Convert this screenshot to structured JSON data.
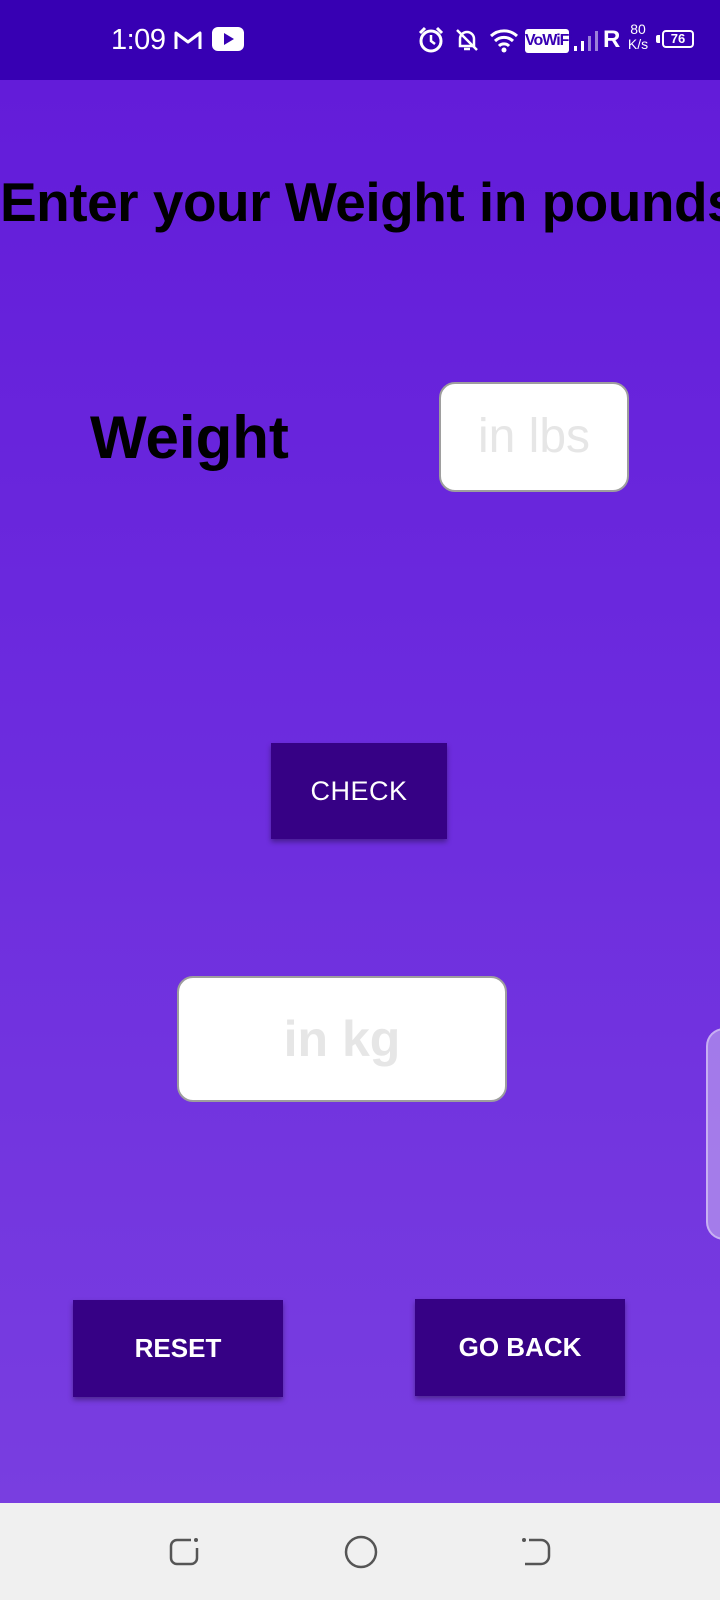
{
  "status_bar": {
    "time": "1:09",
    "icons": [
      "gmail-icon",
      "youtube-icon",
      "alarm-icon",
      "notifications-off-icon",
      "wifi-icon",
      "vowifi-icon",
      "signal-icon"
    ],
    "vowifi_label": "VoWiFi",
    "roaming_label": "R",
    "speed_value": "80",
    "speed_unit": "K/s",
    "battery_level": "76"
  },
  "main": {
    "heading": "Enter your Weight in pounds",
    "weight_label": "Weight",
    "lbs_input": {
      "value": "",
      "placeholder": "in lbs"
    },
    "check_button": "CHECK",
    "kg_output": {
      "value": "",
      "placeholder": "in kg"
    },
    "reset_button": "RESET",
    "go_back_button": "GO BACK"
  },
  "navigation_bar": {
    "buttons": [
      "recent-apps-icon",
      "home-icon",
      "back-icon"
    ]
  },
  "colors": {
    "status_bar": "#3700b3",
    "background_top": "#631cd9",
    "background_bottom": "#793ee0",
    "button": "#360185",
    "input_background": "#ffffff",
    "placeholder_text": "#e6e6e6",
    "nav_bar": "#f0f0f0"
  }
}
